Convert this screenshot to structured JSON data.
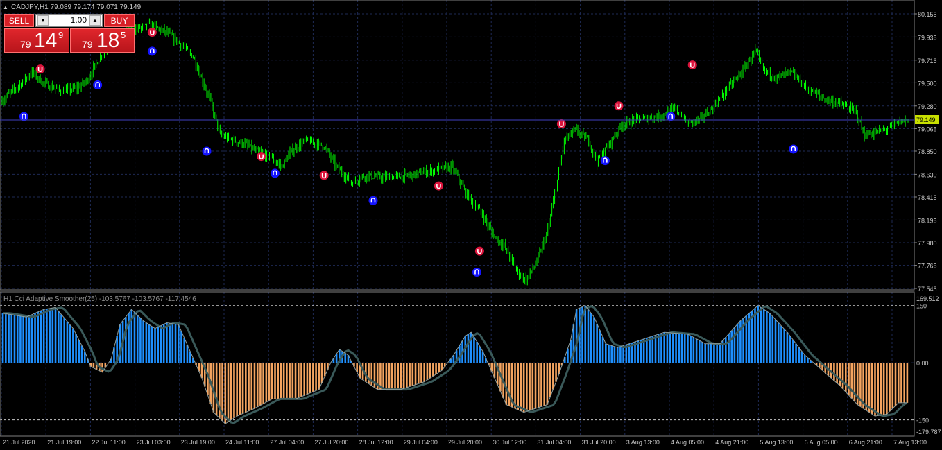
{
  "symbol_header": {
    "text": "CADJPY,H1  79.089 79.174 79.071 79.149"
  },
  "trade_panel": {
    "sell_label": "SELL",
    "buy_label": "BUY",
    "lot": "1.00",
    "sell_price": {
      "small": "79",
      "big": "14",
      "sup": "9"
    },
    "buy_price": {
      "small": "79",
      "big": "18",
      "sup": "5"
    }
  },
  "indicator_header": {
    "text": "H1 Cci Adaptive Smoother(25) -103.5767 -103.5767 -117.4546"
  },
  "colors": {
    "background": "#000000",
    "grid": "#1e2a55",
    "candle": "#00ff00",
    "arrow_up": "#1414ff",
    "arrow_down": "#dc143c",
    "hist_positive": "#1e90ff",
    "hist_negative": "#f4a460",
    "signal_line": "#2f4f4f",
    "axis_text": "#c8c8c8",
    "current_price_bg": "#c8e000"
  },
  "chart_data": [
    {
      "type": "candlestick",
      "symbol": "CADJPY",
      "timeframe": "H1",
      "ohlc_last": {
        "open": 79.089,
        "high": 79.174,
        "low": 79.071,
        "close": 79.149
      },
      "current_price": "79.149",
      "y_ticks": [
        "80.155",
        "79.935",
        "79.715",
        "79.500",
        "79.280",
        "79.065",
        "78.850",
        "78.630",
        "78.415",
        "78.195",
        "77.980",
        "77.765",
        "77.545"
      ],
      "ylim": [
        77.545,
        80.155
      ],
      "x_ticks": [
        "21 Jul 2020",
        "21 Jul 19:00",
        "22 Jul 11:00",
        "23 Jul 03:00",
        "23 Jul 19:00",
        "24 Jul 11:00",
        "27 Jul 04:00",
        "27 Jul 20:00",
        "28 Jul 12:00",
        "29 Jul 04:00",
        "29 Jul 20:00",
        "30 Jul 12:00",
        "31 Jul 04:00",
        "31 Jul 20:00",
        "3 Aug 13:00",
        "4 Aug 05:00",
        "4 Aug 21:00",
        "5 Aug 13:00",
        "6 Aug 05:00",
        "6 Aug 21:00",
        "7 Aug 13:00"
      ],
      "path_keypoints": [
        [
          0,
          79.33
        ],
        [
          10,
          79.45
        ],
        [
          22,
          79.6
        ],
        [
          30,
          79.5
        ],
        [
          42,
          79.42
        ],
        [
          55,
          79.45
        ],
        [
          62,
          79.52
        ],
        [
          72,
          79.75
        ],
        [
          82,
          79.93
        ],
        [
          95,
          80.0
        ],
        [
          108,
          80.05
        ],
        [
          120,
          79.98
        ],
        [
          128,
          79.9
        ],
        [
          140,
          79.75
        ],
        [
          152,
          79.35
        ],
        [
          160,
          79.0
        ],
        [
          170,
          78.95
        ],
        [
          178,
          78.92
        ],
        [
          186,
          78.85
        ],
        [
          196,
          78.8
        ],
        [
          205,
          78.7
        ],
        [
          212,
          78.85
        ],
        [
          222,
          78.95
        ],
        [
          236,
          78.9
        ],
        [
          245,
          78.7
        ],
        [
          256,
          78.55
        ],
        [
          266,
          78.62
        ],
        [
          280,
          78.6
        ],
        [
          300,
          78.62
        ],
        [
          320,
          78.68
        ],
        [
          330,
          78.7
        ],
        [
          340,
          78.45
        ],
        [
          352,
          78.25
        ],
        [
          360,
          78.05
        ],
        [
          368,
          77.95
        ],
        [
          378,
          77.7
        ],
        [
          384,
          77.62
        ],
        [
          392,
          77.8
        ],
        [
          400,
          78.1
        ],
        [
          406,
          78.5
        ],
        [
          412,
          78.95
        ],
        [
          420,
          79.05
        ],
        [
          430,
          78.95
        ],
        [
          436,
          78.75
        ],
        [
          444,
          78.9
        ],
        [
          454,
          79.1
        ],
        [
          466,
          79.15
        ],
        [
          480,
          79.18
        ],
        [
          494,
          79.25
        ],
        [
          502,
          79.12
        ],
        [
          512,
          79.15
        ],
        [
          522,
          79.28
        ],
        [
          532,
          79.45
        ],
        [
          542,
          79.6
        ],
        [
          552,
          79.8
        ],
        [
          558,
          79.62
        ],
        [
          568,
          79.55
        ],
        [
          578,
          79.6
        ],
        [
          590,
          79.45
        ],
        [
          602,
          79.35
        ],
        [
          614,
          79.3
        ],
        [
          626,
          79.22
        ],
        [
          632,
          79.0
        ],
        [
          646,
          79.05
        ],
        [
          658,
          79.13
        ],
        [
          664,
          79.15
        ]
      ],
      "up_arrows": [
        [
          8,
          79.18
        ],
        [
          35,
          79.48
        ],
        [
          55,
          79.8
        ],
        [
          75,
          78.85
        ],
        [
          100,
          78.64
        ],
        [
          136,
          78.38
        ],
        [
          174,
          77.7
        ],
        [
          221,
          78.76
        ],
        [
          245,
          79.18
        ],
        [
          290,
          78.87
        ]
      ],
      "down_arrows": [
        [
          14,
          79.63
        ],
        [
          55,
          79.98
        ],
        [
          95,
          78.8
        ],
        [
          118,
          78.62
        ],
        [
          160,
          78.52
        ],
        [
          175,
          77.9
        ],
        [
          205,
          79.11
        ],
        [
          226,
          79.28
        ],
        [
          253,
          79.67
        ]
      ]
    },
    {
      "type": "bar",
      "name": "H1 Cci Adaptive Smoother(25)",
      "values_last": [
        -103.5767,
        -103.5767,
        -117.4546
      ],
      "y_ticks": [
        "169.512",
        "150",
        "0.00",
        "-150",
        "-179.787"
      ],
      "ylim": [
        -179.787,
        169.512
      ],
      "levels": [
        150,
        -150
      ],
      "keypoints": [
        [
          0,
          130
        ],
        [
          8,
          120
        ],
        [
          14,
          140
        ],
        [
          18,
          145
        ],
        [
          24,
          90
        ],
        [
          28,
          30
        ],
        [
          30,
          -10
        ],
        [
          34,
          -25
        ],
        [
          37,
          10
        ],
        [
          40,
          100
        ],
        [
          44,
          140
        ],
        [
          48,
          110
        ],
        [
          52,
          90
        ],
        [
          56,
          105
        ],
        [
          60,
          100
        ],
        [
          64,
          30
        ],
        [
          68,
          -40
        ],
        [
          72,
          -130
        ],
        [
          76,
          -160
        ],
        [
          80,
          -140
        ],
        [
          86,
          -120
        ],
        [
          92,
          -95
        ],
        [
          100,
          -95
        ],
        [
          108,
          -70
        ],
        [
          112,
          0
        ],
        [
          115,
          35
        ],
        [
          118,
          20
        ],
        [
          122,
          -40
        ],
        [
          128,
          -70
        ],
        [
          136,
          -70
        ],
        [
          144,
          -50
        ],
        [
          150,
          -20
        ],
        [
          154,
          20
        ],
        [
          158,
          70
        ],
        [
          160,
          80
        ],
        [
          164,
          30
        ],
        [
          168,
          -40
        ],
        [
          172,
          -110
        ],
        [
          178,
          -130
        ],
        [
          186,
          -110
        ],
        [
          190,
          -30
        ],
        [
          194,
          60
        ],
        [
          196,
          140
        ],
        [
          199,
          150
        ],
        [
          202,
          120
        ],
        [
          206,
          50
        ],
        [
          210,
          40
        ],
        [
          218,
          60
        ],
        [
          226,
          80
        ],
        [
          234,
          75
        ],
        [
          240,
          50
        ],
        [
          245,
          50
        ],
        [
          252,
          110
        ],
        [
          258,
          150
        ],
        [
          262,
          130
        ],
        [
          268,
          80
        ],
        [
          274,
          20
        ],
        [
          280,
          -20
        ],
        [
          286,
          -60
        ],
        [
          292,
          -110
        ],
        [
          298,
          -140
        ],
        [
          302,
          -135
        ],
        [
          306,
          -105
        ]
      ]
    }
  ]
}
